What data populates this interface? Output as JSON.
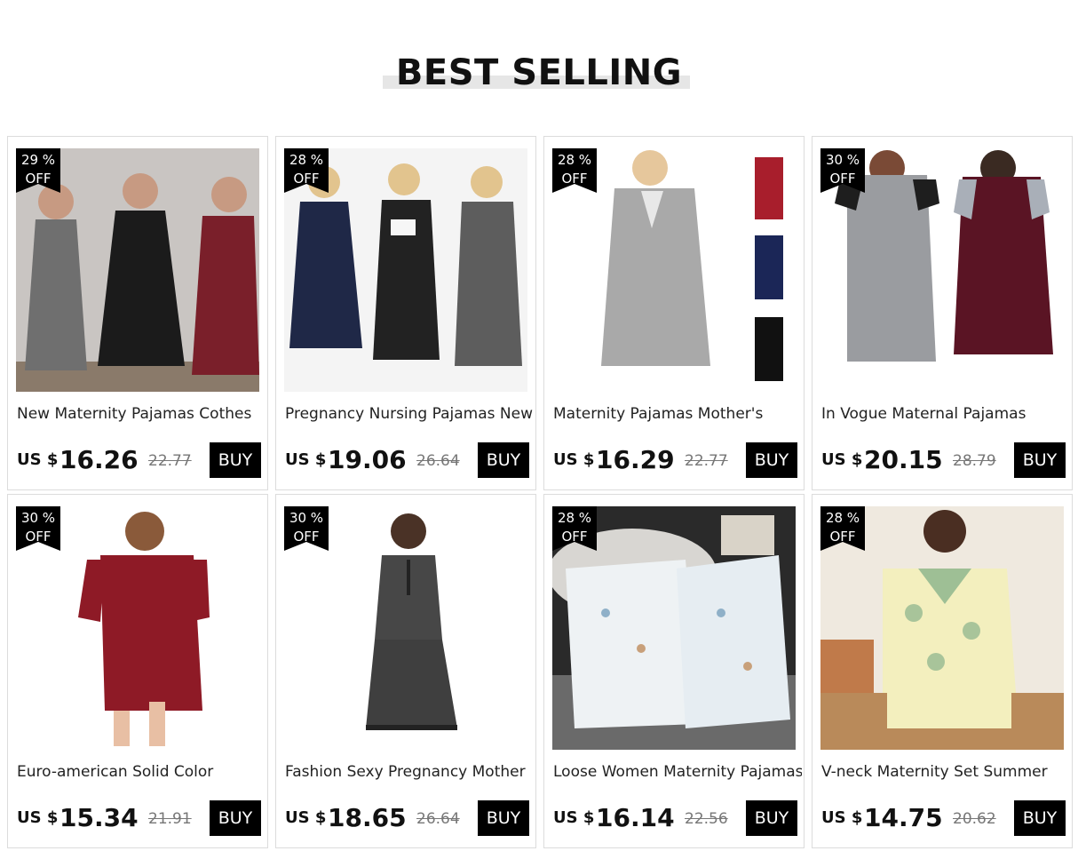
{
  "section": {
    "title": "BEST SELLING"
  },
  "currency_label": "US $",
  "buy_label": "BUY",
  "badge_off": "OFF",
  "products": [
    {
      "name": "New Maternity Pajamas Cothes",
      "discount": "29 %",
      "price": "16.26",
      "old_price": "22.77",
      "image": "three-women-dresses-grey-black-wine"
    },
    {
      "name": "Pregnancy Nursing Pajamas New",
      "discount": "28 %",
      "price": "19.06",
      "old_price": "26.64",
      "image": "three-women-sleeveless-navy-black-grey"
    },
    {
      "name": "Maternity Pajamas Mother's",
      "discount": "28 %",
      "price": "16.29",
      "old_price": "22.77",
      "image": "grey-nursing-dress-with-color-variants"
    },
    {
      "name": "In Vogue Maternal Pajamas",
      "discount": "30 %",
      "price": "20.15",
      "old_price": "28.79",
      "image": "grey-and-wine-raglan-dresses"
    },
    {
      "name": "Euro-american Solid Color",
      "discount": "30 %",
      "price": "15.34",
      "old_price": "21.91",
      "image": "red-satin-sleep-shirt"
    },
    {
      "name": "Fashion Sexy Pregnancy Mother",
      "discount": "30 %",
      "price": "18.65",
      "old_price": "26.64",
      "image": "dark-grey-strap-nightdress"
    },
    {
      "name": "Loose Women Maternity Pajamas",
      "discount": "28 %",
      "price": "16.14",
      "old_price": "22.56",
      "image": "white-printed-pajama-set-flatlay"
    },
    {
      "name": "V-neck Maternity Set Summer",
      "discount": "28 %",
      "price": "14.75",
      "old_price": "20.62",
      "image": "yellow-vneck-shorts-set"
    }
  ]
}
